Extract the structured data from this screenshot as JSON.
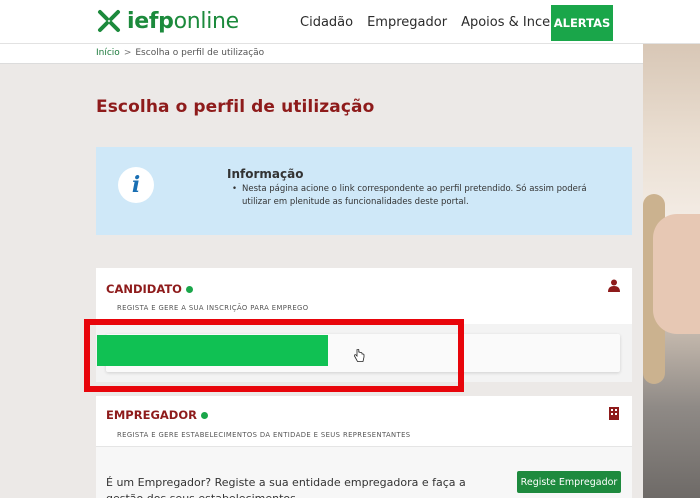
{
  "header": {
    "logo_text": "iefponline",
    "nav": [
      "Cidadão",
      "Empregador",
      "Apoios & Incentivos"
    ],
    "alert_button": "ALERTAS"
  },
  "breadcrumb": {
    "home": "Início",
    "separator": ">",
    "current": "Escolha o perfil de utilização"
  },
  "page": {
    "title": "Escolha o perfil de utilização"
  },
  "info": {
    "icon": "info-icon",
    "icon_glyph": "i",
    "title": "Informação",
    "bullet": "•",
    "text": "Nesta página acione o link correspondente ao perfil pretendido. Só assim poderá utilizar em plenitude as funcionalidades deste portal."
  },
  "candidato": {
    "title": "CANDIDATO",
    "subtitle": "REGISTA E GERE A SUA INSCRIÇÃO PARA EMPREGO",
    "icon": "user-icon"
  },
  "empregador": {
    "title": "EMPREGADOR",
    "subtitle": "REGISTA E GERE ESTABELECIMENTOS DA ENTIDADE E SEUS REPRESENTANTES",
    "icon": "building-icon",
    "body_text": "É um Empregador? Registe a sua entidade empregadora e faça a gestão dos seus estabelecimentos",
    "button": "Registe Empregador"
  },
  "colors": {
    "brand_green": "#1aa64a",
    "title_red": "#8e1b1b",
    "info_bg": "#cfe8f8",
    "highlight_red": "#e8050b"
  }
}
